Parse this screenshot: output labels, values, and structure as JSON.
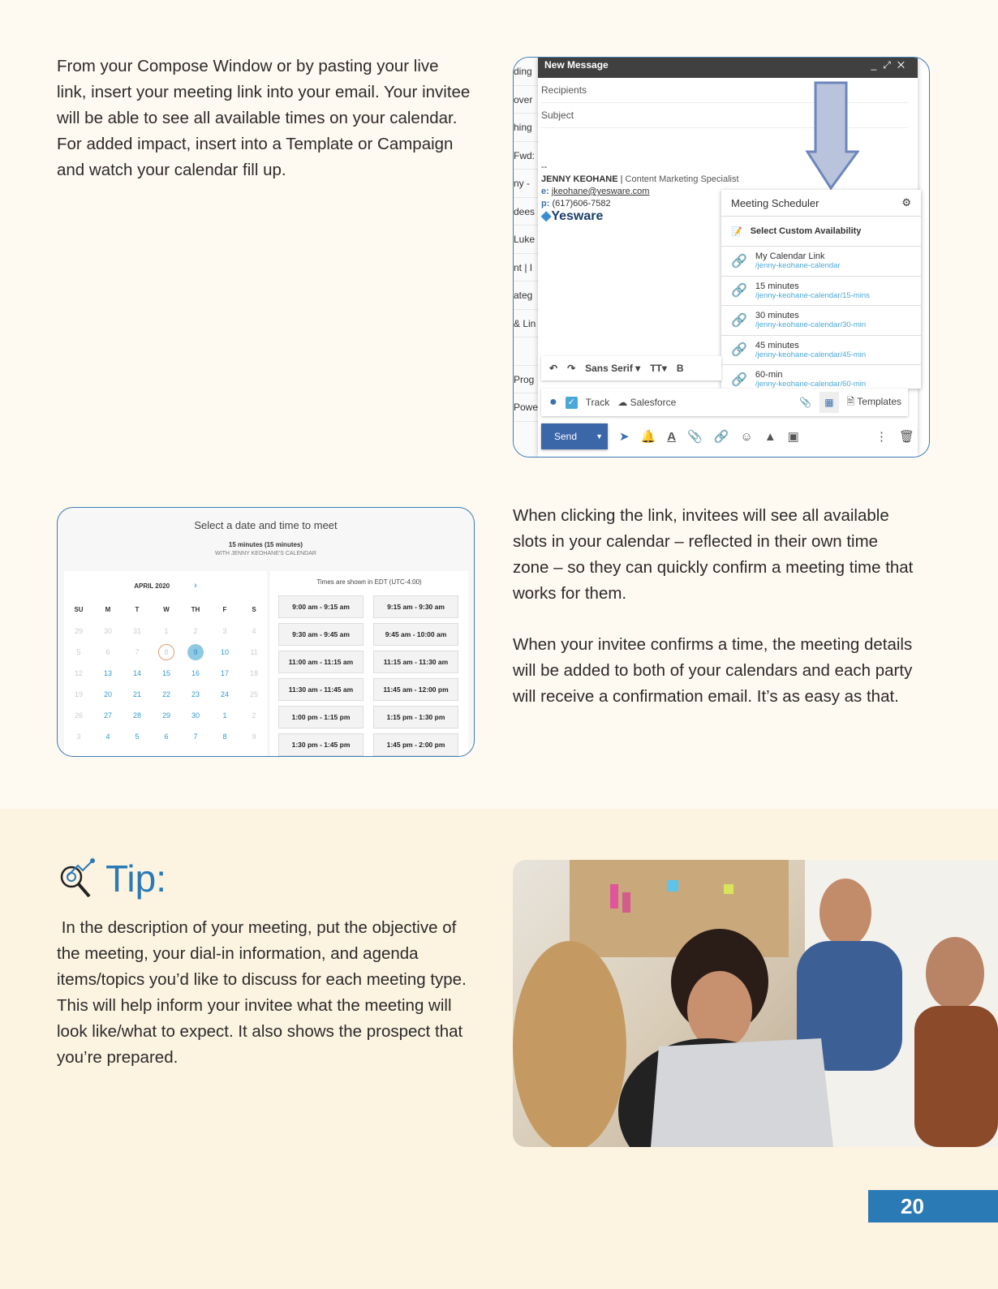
{
  "intro_text": "From your Compose Window or by pasting your live link, insert your meeting link into your email. Your invitee will be able to see all available times on your calendar. For added impact, insert into a Template or Campaign and watch your calendar fill up.",
  "compose": {
    "background_fragments": [
      "ding",
      "over",
      "hing",
      "Fwd:",
      "ny -",
      "dees",
      "Luke",
      "nt | I",
      "ateg",
      "& Lin",
      "",
      "Prog",
      "Powe"
    ],
    "title": "New Message",
    "window_controls": [
      "_",
      "⤢",
      "✕"
    ],
    "recipients_placeholder": "Recipients",
    "subject_placeholder": "Subject",
    "signature": {
      "dashes": "--",
      "name": "JENNY KEOHANE",
      "separator": "|",
      "role": "Content Marketing Specialist",
      "email_label": "e:",
      "email": "jkeohane@yesware.com",
      "phone_label": "p:",
      "phone": "(617)606-7582",
      "logo": "Yesware"
    },
    "scheduler": {
      "title": "Meeting Scheduler",
      "custom": "Select Custom Availability",
      "links": [
        {
          "title": "My Calendar Link",
          "url": "/jenny-keohane-calendar"
        },
        {
          "title": "15 minutes",
          "url": "/jenny-keohane-calendar/15-mins"
        },
        {
          "title": "30 minutes",
          "url": "/jenny-keohane-calendar/30-min"
        },
        {
          "title": "45 minutes",
          "url": "/jenny-keohane-calendar/45-min"
        },
        {
          "title": "60-min",
          "url": "/jenny-keohane-calendar/60-min"
        }
      ]
    },
    "format": {
      "font": "Sans Serif",
      "bold": "B"
    },
    "toolbar": {
      "track": "Track",
      "salesforce": "Salesforce",
      "templates": "Templates"
    },
    "send": "Send"
  },
  "calendar": {
    "title": "Select a date and time to meet",
    "subtitle": "15 minutes (15 minutes)",
    "owner": "WITH JENNY KEOHANE'S CALENDAR",
    "month": "APRIL  2020",
    "next": "›",
    "timezone": "Times are shown in EDT (UTC-4:00)",
    "weekdays": [
      "SU",
      "M",
      "T",
      "W",
      "TH",
      "F",
      "S"
    ],
    "weeks": [
      [
        "29",
        "30",
        "31",
        "1",
        "2",
        "3",
        "4"
      ],
      [
        "5",
        "6",
        "7",
        "8",
        "9",
        "10",
        "11"
      ],
      [
        "12",
        "13",
        "14",
        "15",
        "16",
        "17",
        "18"
      ],
      [
        "19",
        "20",
        "21",
        "22",
        "23",
        "24",
        "25"
      ],
      [
        "26",
        "27",
        "28",
        "29",
        "30",
        "1",
        "2"
      ],
      [
        "3",
        "4",
        "5",
        "6",
        "7",
        "8",
        "9"
      ]
    ],
    "today": "8",
    "selected": "9",
    "slots": [
      "9:00 am - 9:15 am",
      "9:15 am - 9:30 am",
      "9:30 am - 9:45 am",
      "9:45 am - 10:00 am",
      "11:00 am - 11:15 am",
      "11:15 am - 11:30 am",
      "11:30 am - 11:45 am",
      "11:45 am - 12:00 pm",
      "1:00 pm - 1:15 pm",
      "1:15 pm - 1:30 pm",
      "1:30 pm - 1:45 pm",
      "1:45 pm - 2:00 pm"
    ]
  },
  "right_text_1": "When clicking the link, invitees will see all available slots in your calendar – reflected in their own time zone – so they can quickly confirm a meeting time that works for them.",
  "right_text_2": "When your invitee confirms a time, the meeting details will be added to both of your calendars and each party will receive a confirmation email. It’s as easy as that.",
  "tip": {
    "heading": "Tip:",
    "text": " In the description of your meeting, put the objective of the meeting, your dial-in information, and agenda items/topics you’d like to discuss for each meeting type. This will help inform your invitee what the meeting will look like/what to expect. It also shows the prospect that you’re prepared."
  },
  "page_number": "20",
  "colors": {
    "accent": "#2a7ab5",
    "link": "#4aa8d8",
    "page_bg": "#fffaf1",
    "tip_bg": "#fdf3e1"
  }
}
